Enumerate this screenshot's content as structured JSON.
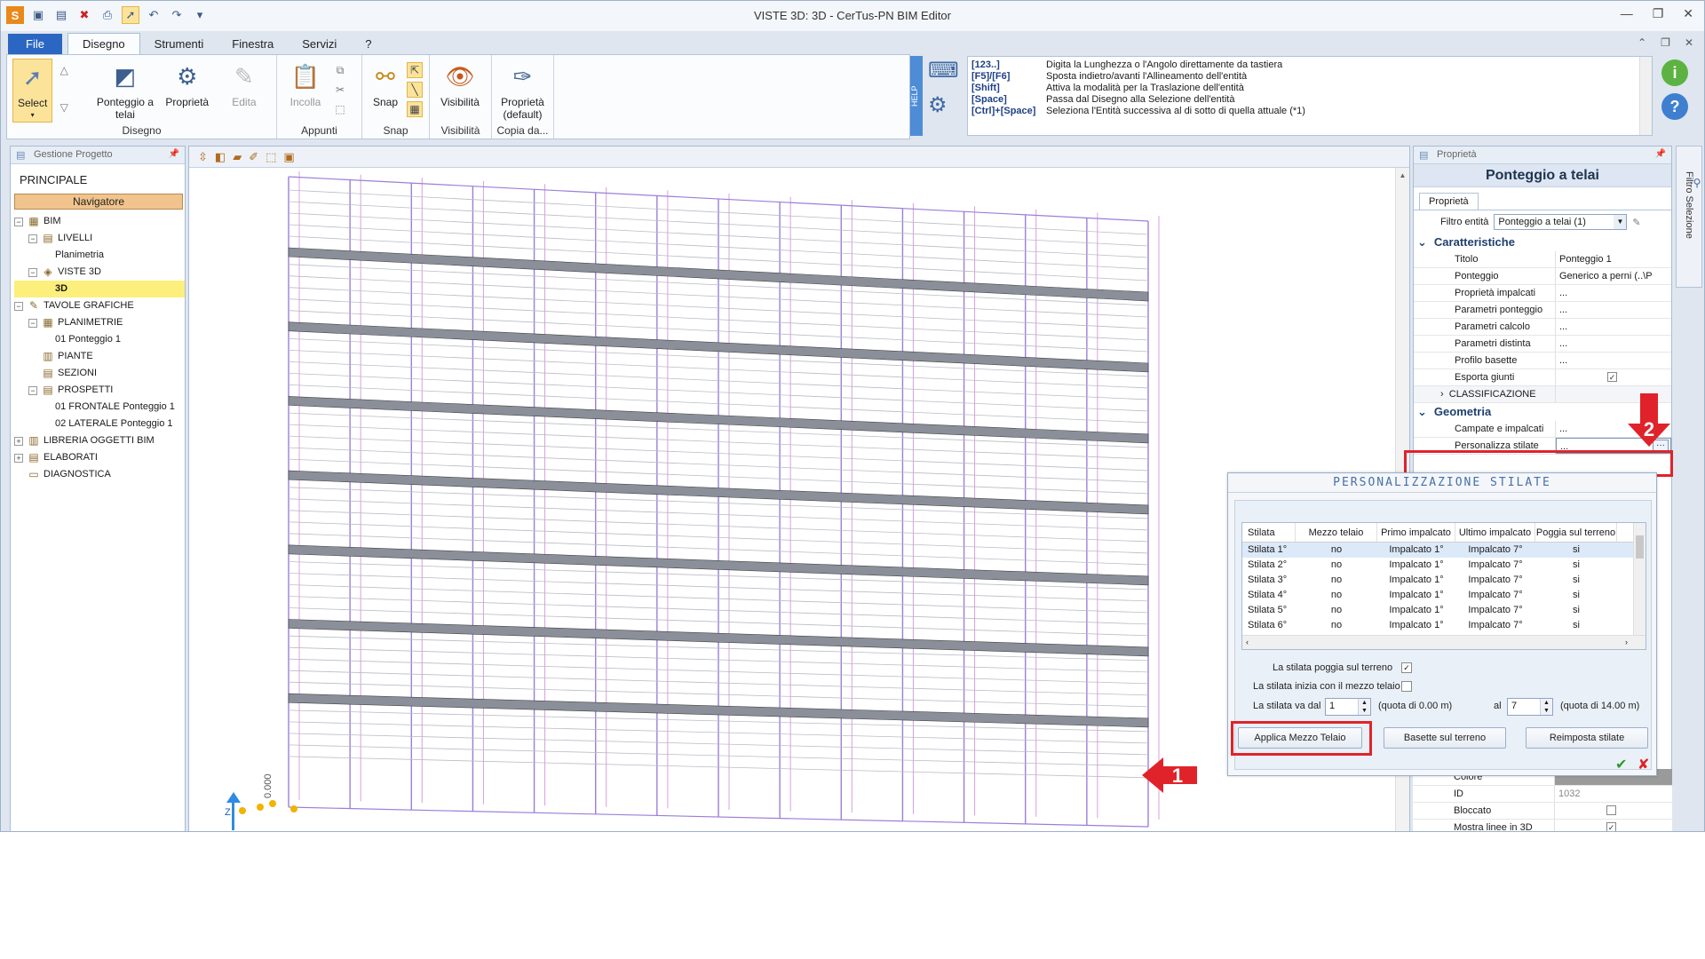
{
  "app": {
    "title": "VISTE 3D: 3D - CerTus-PN BIM Editor"
  },
  "ribbon_tabs": [
    "File",
    "Disegno",
    "Strumenti",
    "Finestra",
    "Servizi",
    "?"
  ],
  "ribbon": {
    "select": "Select",
    "ponteggio": "Ponteggio a telai",
    "proprieta": "Proprietà",
    "edita": "Edita",
    "incolla": "Incolla",
    "snap": "Snap",
    "visibilita": "Visibilità",
    "proprieta_default": "Proprietà (default)",
    "groups": {
      "disegno": "Disegno",
      "appunti": "Appunti",
      "snap": "Snap",
      "visibilita": "Visibilità",
      "copia": "Copia da..."
    },
    "help_label": "HELP"
  },
  "help": {
    "rows": [
      {
        "key": "[123..]",
        "text": "Digita la Lunghezza o l'Angolo direttamente da tastiera"
      },
      {
        "key": "[F5]/[F6]",
        "text": "Sposta indietro/avanti l'Allineamento dell'entità"
      },
      {
        "key": "[Shift]",
        "text": "Attiva la modalità per la Traslazione dell'entità"
      },
      {
        "key": "[Space]",
        "text": "Passa dal Disegno alla Selezione dell'entità"
      },
      {
        "key": "[Ctrl]+[Space]",
        "text": "Seleziona l'Entità successiva al di sotto di quella attuale (*1)"
      }
    ]
  },
  "left_panel": {
    "header": "Gestione Progetto",
    "principale": "PRINCIPALE",
    "navigatore": "Navigatore",
    "tree": [
      {
        "label": "BIM",
        "level": 0,
        "expander": "−"
      },
      {
        "label": "LIVELLI",
        "level": 1,
        "expander": "−"
      },
      {
        "label": "Planimetria",
        "level": 2,
        "expander": ""
      },
      {
        "label": "VISTE 3D",
        "level": 1,
        "expander": "−"
      },
      {
        "label": "3D",
        "level": 2,
        "expander": "",
        "selected": true
      },
      {
        "label": "TAVOLE GRAFICHE",
        "level": 0,
        "expander": "−"
      },
      {
        "label": "PLANIMETRIE",
        "level": 1,
        "expander": "−"
      },
      {
        "label": "01 Ponteggio 1",
        "level": 2,
        "expander": ""
      },
      {
        "label": "PIANTE",
        "level": 1,
        "expander": ""
      },
      {
        "label": "SEZIONI",
        "level": 1,
        "expander": ""
      },
      {
        "label": "PROSPETTI",
        "level": 1,
        "expander": "−"
      },
      {
        "label": "01 FRONTALE Ponteggio 1",
        "level": 2,
        "expander": ""
      },
      {
        "label": "02 LATERALE Ponteggio 1",
        "level": 2,
        "expander": ""
      },
      {
        "label": "LIBRERIA OGGETTI BIM",
        "level": 0,
        "expander": "+"
      },
      {
        "label": "ELABORATI",
        "level": 0,
        "expander": "+"
      },
      {
        "label": "DIAGNOSTICA",
        "level": 0,
        "expander": ""
      }
    ]
  },
  "canvas": {
    "origin_label": "0.000",
    "z_label": "Z"
  },
  "right_panel": {
    "header": "Proprietà",
    "title": "Ponteggio a telai",
    "tab": "Proprietà",
    "filter_label": "Filtro entità",
    "filter_value": "Ponteggio a telai (1)",
    "cat1": "Caratteristiche",
    "cat2": "Geometria",
    "rows": [
      {
        "name": "Titolo",
        "value": "Ponteggio 1"
      },
      {
        "name": "Ponteggio",
        "value": "Generico a perni   (..\\P"
      },
      {
        "name": "Proprietà impalcati",
        "value": "..."
      },
      {
        "name": "Parametri ponteggio",
        "value": "..."
      },
      {
        "name": "Parametri calcolo",
        "value": "..."
      },
      {
        "name": "Parametri distinta",
        "value": "..."
      },
      {
        "name": "Profilo basette",
        "value": "..."
      },
      {
        "name": "Esporta giunti",
        "value": "✓"
      }
    ],
    "classificazione": "CLASSIFICAZIONE",
    "geo_rows": [
      {
        "name": "Campate e impalcati",
        "value": "..."
      },
      {
        "name": "Personalizza stilate",
        "value": "..."
      }
    ],
    "bottom_rows": [
      {
        "name": "Colore",
        "value": ""
      },
      {
        "name": "ID",
        "value": "1032"
      },
      {
        "name": "Bloccato",
        "value": ""
      },
      {
        "name": "Mostra linee in 3D",
        "value": "✓"
      }
    ],
    "side_filter": "Filtro Selezione"
  },
  "dialog": {
    "title": "PERSONALIZZAZIONE STILATE",
    "columns": [
      "Stilata",
      "Mezzo telaio",
      "Primo impalcato",
      "Ultimo impalcato",
      "Poggia sul terreno"
    ],
    "rows": [
      [
        "Stilata 1°",
        "no",
        "Impalcato 1°",
        "Impalcato 7°",
        "si"
      ],
      [
        "Stilata 2°",
        "no",
        "Impalcato 1°",
        "Impalcato 7°",
        "si"
      ],
      [
        "Stilata 3°",
        "no",
        "Impalcato 1°",
        "Impalcato 7°",
        "si"
      ],
      [
        "Stilata 4°",
        "no",
        "Impalcato 1°",
        "Impalcato 7°",
        "si"
      ],
      [
        "Stilata 5°",
        "no",
        "Impalcato 1°",
        "Impalcato 7°",
        "si"
      ],
      [
        "Stilata 6°",
        "no",
        "Impalcato 1°",
        "Impalcato 7°",
        "si"
      ]
    ],
    "check1_label": "La stilata poggia sul terreno",
    "check2_label": "La stilata inizia con il mezzo telaio",
    "range_label": "La stilata va dal",
    "from_value": "1",
    "from_quota": "(quota di 0.00 m)",
    "al_label": "al",
    "to_value": "7",
    "to_quota": "(quota di 14.00 m)",
    "btn_applica": "Applica Mezzo Telaio",
    "btn_basette": "Basette sul terreno",
    "btn_reimposta": "Reimposta stilate"
  },
  "annotations": {
    "badge1": "1",
    "badge2": "2"
  },
  "colors": {
    "highlight_red": "#e0232a",
    "ribbon_accent": "#2b67c2",
    "selection_yellow": "#fcef7c"
  }
}
